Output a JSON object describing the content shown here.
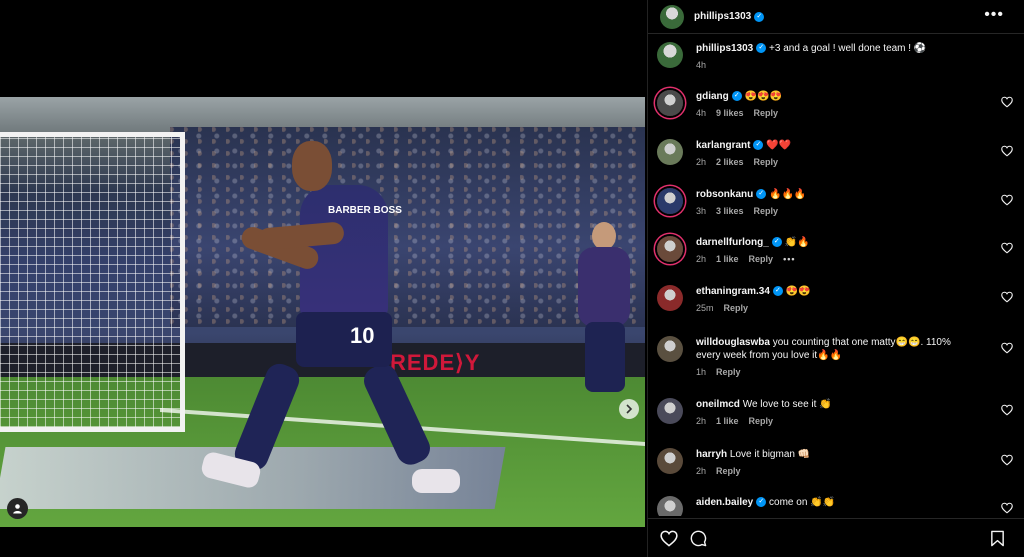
{
  "post": {
    "author": "phillips1303",
    "caption": "+3 and a goal ! well done team ! ⚽",
    "caption_time": "4h",
    "photo": {
      "sponsor_text": "BARBER BOSS",
      "shirt_number": "10",
      "ad_board_text": "REDE⟩Y"
    }
  },
  "colors": {
    "verified": "#0095f6",
    "background": "#000000",
    "meta": "#a8a8a8"
  },
  "comments": [
    {
      "user": "gdiang",
      "text": "😍😍😍",
      "time": "4h",
      "likes": "9 likes",
      "reply": "Reply",
      "avatar_color": "#4a4a4a",
      "ring": true
    },
    {
      "user": "karlangrant",
      "text": "❤️❤️",
      "time": "2h",
      "likes": "2 likes",
      "reply": "Reply",
      "avatar_color": "#6a7a5a",
      "ring": false
    },
    {
      "user": "robsonkanu",
      "text": "🔥🔥🔥",
      "time": "3h",
      "likes": "3 likes",
      "reply": "Reply",
      "avatar_color": "#2a3a6a",
      "ring": true
    },
    {
      "user": "darnellfurlong_",
      "text": "👏🔥",
      "time": "2h",
      "likes": "1 like",
      "reply": "Reply",
      "more": "•••",
      "avatar_color": "#6a4a3a",
      "ring": true
    },
    {
      "user": "ethaningram.34",
      "text": "😍😍",
      "time": "25m",
      "likes": "",
      "reply": "Reply",
      "avatar_color": "#8a2a2a",
      "ring": false
    },
    {
      "user": "willdouglaswba",
      "text": "you counting that one matty😁😁. 110% every week from you love it🔥🔥",
      "time": "1h",
      "likes": "",
      "reply": "Reply",
      "avatar_color": "#5a5040",
      "ring": false
    },
    {
      "user": "oneilmcd",
      "text": "We love to see it 👏",
      "time": "2h",
      "likes": "1 like",
      "reply": "Reply",
      "avatar_color": "#4a4a5a",
      "ring": false
    },
    {
      "user": "harryh",
      "text": "Love it bigman 👊🏻",
      "time": "2h",
      "likes": "",
      "reply": "Reply",
      "avatar_color": "#5a4a3a",
      "ring": false
    },
    {
      "user": "aiden.bailey",
      "text": "come on 👏👏",
      "time": "",
      "likes": "",
      "reply": "",
      "avatar_color": "#6a6a6a",
      "ring": false
    }
  ],
  "icons": {
    "more": "more-options-icon",
    "like": "heart-icon",
    "comment": "comment-icon",
    "save": "bookmark-icon",
    "next": "chevron-right-icon",
    "tag": "user-tag-icon"
  }
}
